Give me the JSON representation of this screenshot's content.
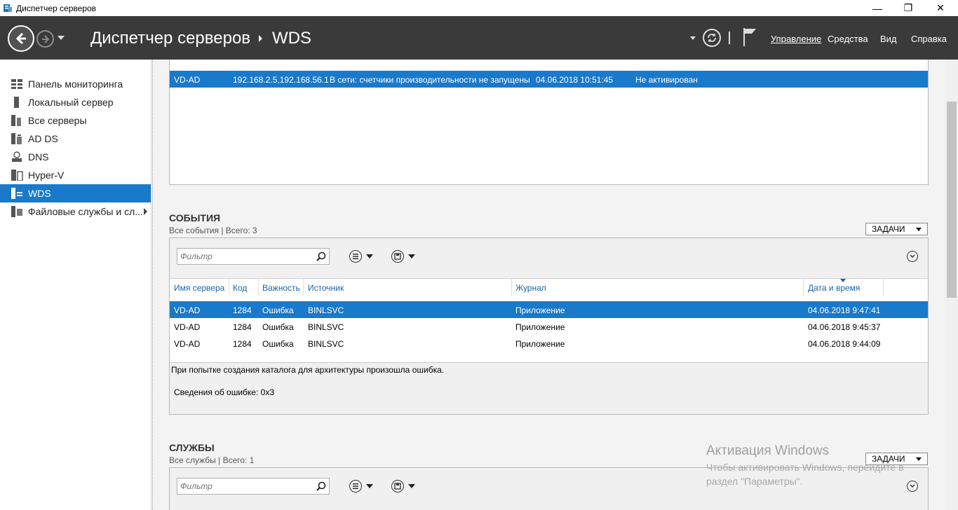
{
  "window": {
    "title": "Диспетчер серверов",
    "minimize": "—",
    "restore": "❐",
    "close": "✕"
  },
  "header": {
    "breadcrumb_root": "Диспетчер серверов",
    "breadcrumb_current": "WDS",
    "menu": [
      "Управление",
      "Средства",
      "Вид",
      "Справка"
    ]
  },
  "sidebar": {
    "items": [
      {
        "label": "Панель мониторинга",
        "icon": "dashboard-icon"
      },
      {
        "label": "Локальный сервер",
        "icon": "local-server-icon"
      },
      {
        "label": "Все серверы",
        "icon": "all-servers-icon"
      },
      {
        "label": "AD DS",
        "icon": "adds-icon"
      },
      {
        "label": "DNS",
        "icon": "dns-icon"
      },
      {
        "label": "Hyper-V",
        "icon": "hyperv-icon"
      },
      {
        "label": "WDS",
        "icon": "wds-icon",
        "active": true
      },
      {
        "label": "Файловые службы и сл...",
        "icon": "file-services-icon"
      }
    ]
  },
  "servers": {
    "rows": [
      {
        "name": "VD-AD",
        "ip": "192.168.2.5,192.168.56.1",
        "status": "В сети: счетчики производительности не запущены",
        "updated": "04.06.2018 10:51:45",
        "activation": "Не активирован"
      }
    ]
  },
  "events": {
    "title": "СОБЫТИЯ",
    "subtitle": "Все события | Всего: 3",
    "tasks": "ЗАДАЧИ",
    "filter_placeholder": "Фильтр",
    "columns": [
      "Имя сервера",
      "Код",
      "Важность",
      "Источник",
      "Журнал",
      "Дата и время"
    ],
    "rows": [
      {
        "server": "VD-AD",
        "code": "1284",
        "severity": "Ошибка",
        "source": "BINLSVC",
        "log": "Приложение",
        "datetime": "04.06.2018 9:47:41"
      },
      {
        "server": "VD-AD",
        "code": "1284",
        "severity": "Ошибка",
        "source": "BINLSVC",
        "log": "Приложение",
        "datetime": "04.06.2018 9:45:37"
      },
      {
        "server": "VD-AD",
        "code": "1284",
        "severity": "Ошибка",
        "source": "BINLSVC",
        "log": "Приложение",
        "datetime": "04.06.2018 9:44:09"
      }
    ],
    "detail_line1": "При попытке создания каталога для архитектуры  произошла ошибка.",
    "detail_line2": "Сведения об ошибке: 0x3"
  },
  "services": {
    "title": "СЛУЖБЫ",
    "subtitle": "Все службы | Всего: 1",
    "tasks": "ЗАДАЧИ",
    "filter_placeholder": "Фильтр"
  },
  "watermark": {
    "title": "Активация Windows",
    "line1": "Чтобы активировать Windows, перейдите в",
    "line2": "раздел \"Параметры\"."
  },
  "colors": {
    "accent": "#1979ca",
    "header_bg": "#3a3a3a"
  }
}
